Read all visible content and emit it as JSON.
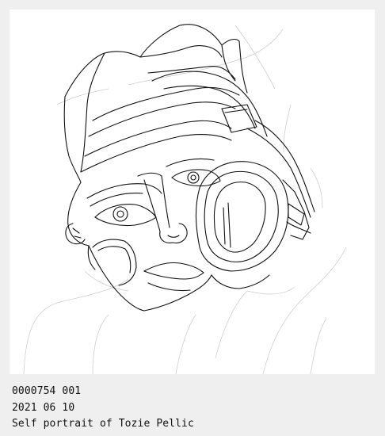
{
  "caption": {
    "record_id": "0000754 001",
    "date": "2021 06 10",
    "title": "Self portrait of Tozie Pellic"
  },
  "colors": {
    "background": "#efefef",
    "paper": "#ffffff",
    "ink": "#111111",
    "faint_ink": "#cfcfcf"
  },
  "artwork": {
    "subject": "line-drawing-self-portrait"
  }
}
